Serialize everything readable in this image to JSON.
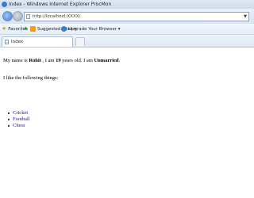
{
  "window": {
    "title": "Index - Windows Internet Explorer ProcMon"
  },
  "address_bar": {
    "url": "http://localhost:XXXX/"
  },
  "favorites_bar": {
    "favorites_label": "Favorites",
    "items": [
      {
        "label": "Suggested Sites ▾"
      },
      {
        "label": "Upgrade Your Browser ▾"
      }
    ]
  },
  "tab": {
    "title": "Index"
  },
  "page": {
    "intro": {
      "prefix": "My name is ",
      "name": "Rohit",
      "middle": " , I am ",
      "age": "19",
      "suffix": " years old. I am ",
      "status": "Unmarried",
      "end": "."
    },
    "like_line": "I like the following things:",
    "hobbies": [
      "Cricket",
      "Football",
      "Chess"
    ]
  },
  "colors": {
    "link": "#1a0dab",
    "chrome": "#dfe8f4"
  }
}
